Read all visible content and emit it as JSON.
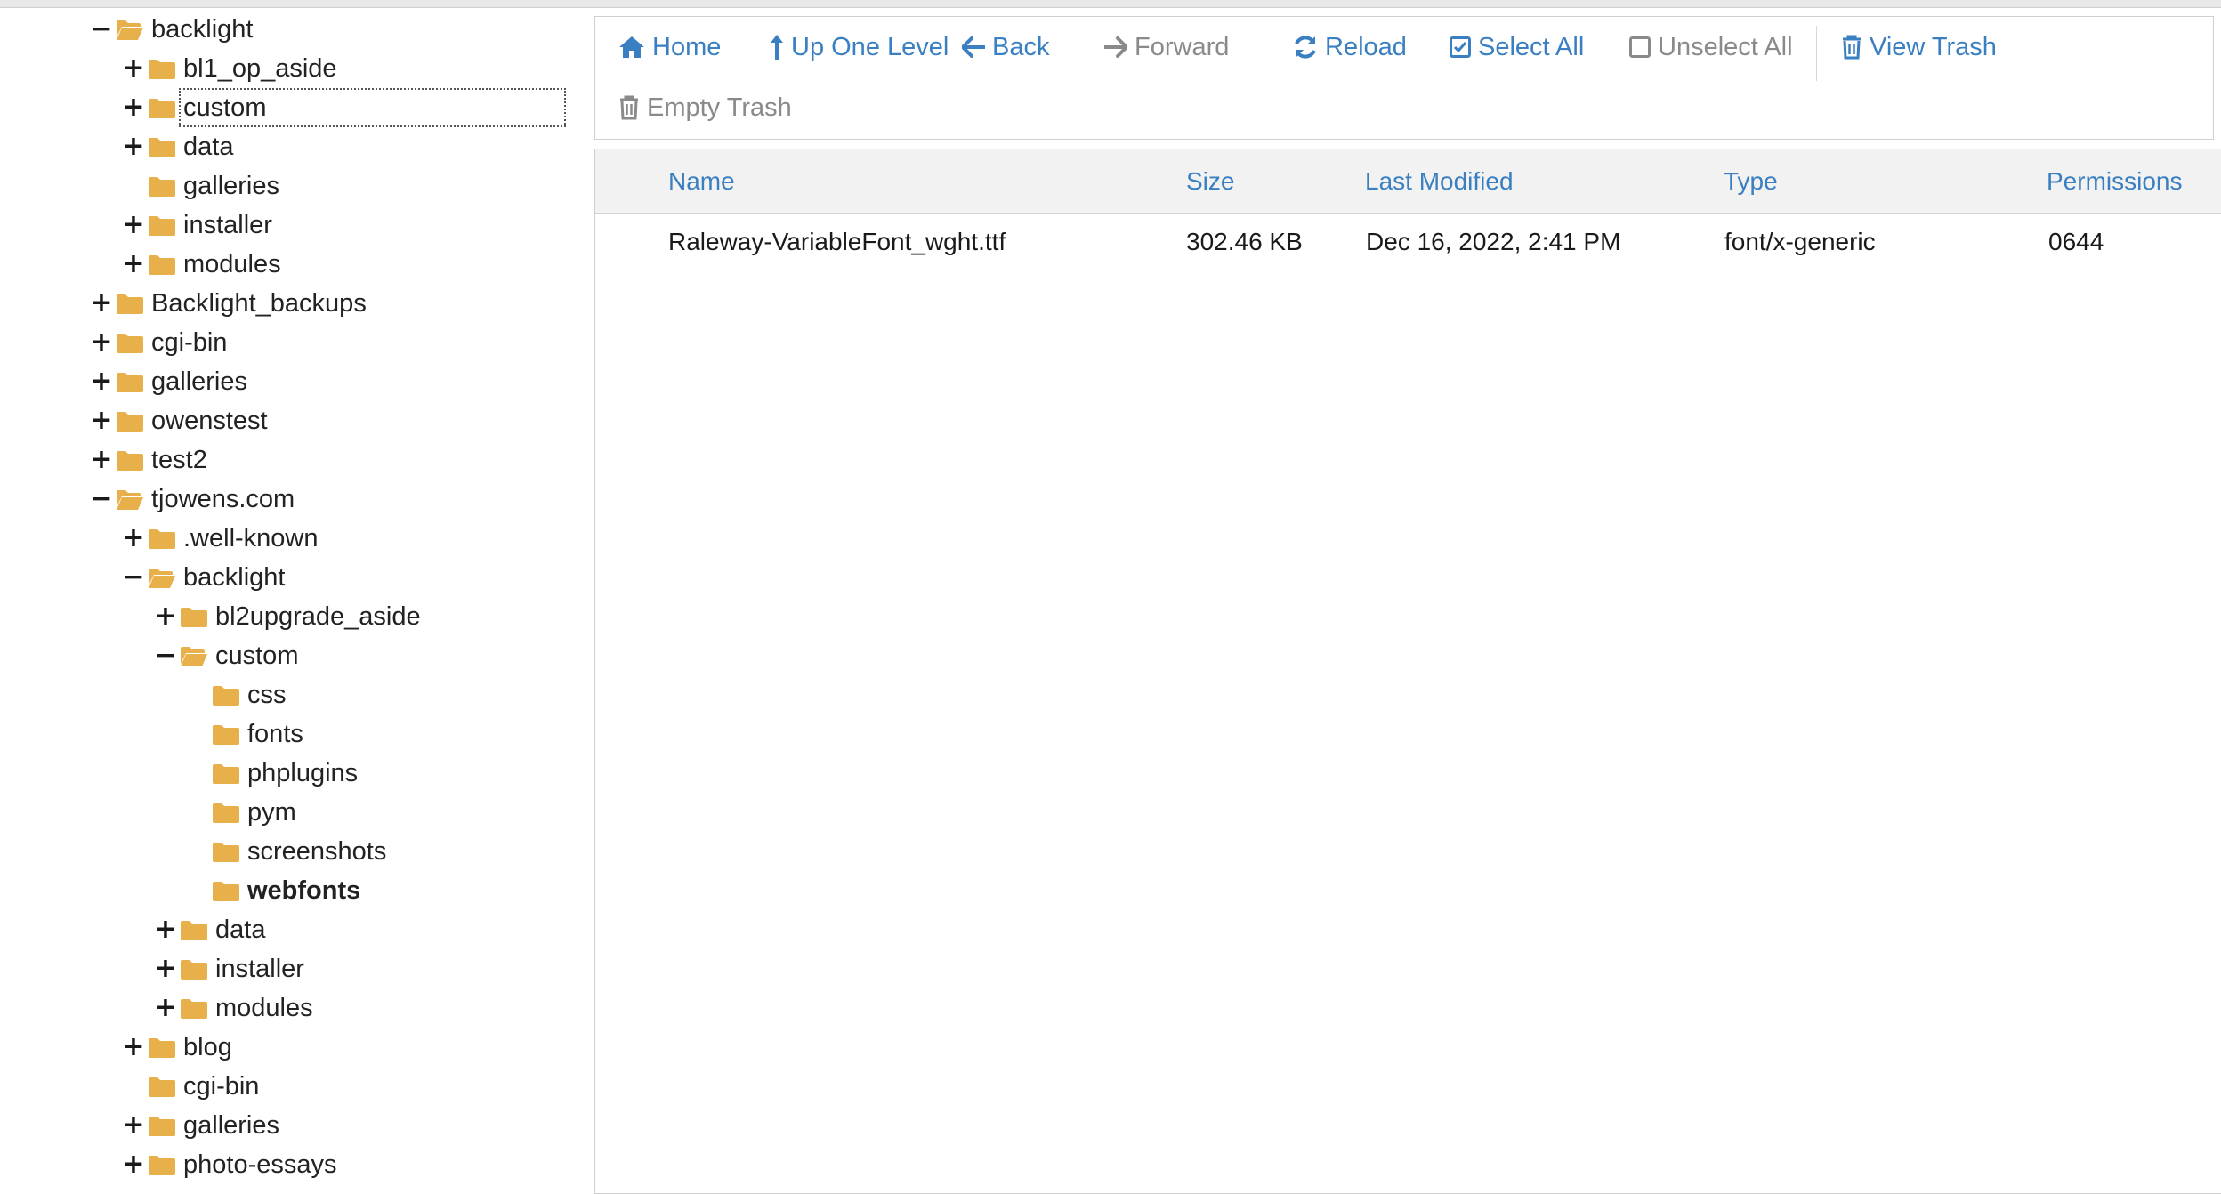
{
  "tree": [
    {
      "label": "backlight",
      "toggle": "−",
      "open": true
    },
    {
      "label": "bl1_op_aside",
      "toggle": "+",
      "open": false
    },
    {
      "label": "custom",
      "toggle": "+",
      "open": false,
      "focused": true
    },
    {
      "label": "data",
      "toggle": "+",
      "open": false
    },
    {
      "label": "galleries",
      "toggle": "",
      "open": false
    },
    {
      "label": "installer",
      "toggle": "+",
      "open": false
    },
    {
      "label": "modules",
      "toggle": "+",
      "open": false
    },
    {
      "label": "Backlight_backups",
      "toggle": "+",
      "open": false
    },
    {
      "label": "cgi-bin",
      "toggle": "+",
      "open": false
    },
    {
      "label": "galleries",
      "toggle": "+",
      "open": false
    },
    {
      "label": "owenstest",
      "toggle": "+",
      "open": false
    },
    {
      "label": "test2",
      "toggle": "+",
      "open": false
    },
    {
      "label": "tjowens.com",
      "toggle": "−",
      "open": true
    },
    {
      "label": ".well-known",
      "toggle": "+",
      "open": false
    },
    {
      "label": "backlight",
      "toggle": "−",
      "open": true
    },
    {
      "label": "bl2upgrade_aside",
      "toggle": "+",
      "open": false
    },
    {
      "label": "custom",
      "toggle": "−",
      "open": true
    },
    {
      "label": "css",
      "toggle": "",
      "open": false
    },
    {
      "label": "fonts",
      "toggle": "",
      "open": false
    },
    {
      "label": "phplugins",
      "toggle": "",
      "open": false
    },
    {
      "label": "pym",
      "toggle": "",
      "open": false
    },
    {
      "label": "screenshots",
      "toggle": "",
      "open": false
    },
    {
      "label": "webfonts",
      "toggle": "",
      "open": false,
      "selected": true
    },
    {
      "label": "data",
      "toggle": "+",
      "open": false
    },
    {
      "label": "installer",
      "toggle": "+",
      "open": false
    },
    {
      "label": "modules",
      "toggle": "+",
      "open": false
    },
    {
      "label": "blog",
      "toggle": "+",
      "open": false
    },
    {
      "label": "cgi-bin",
      "toggle": "",
      "open": false
    },
    {
      "label": "galleries",
      "toggle": "+",
      "open": false
    },
    {
      "label": "photo-essays",
      "toggle": "+",
      "open": false
    }
  ],
  "toolbar": {
    "home": "Home",
    "up_one_level": "Up One Level",
    "back": "Back",
    "forward": "Forward",
    "reload": "Reload",
    "select_all": "Select All",
    "unselect_all": "Unselect All",
    "view_trash": "View Trash",
    "empty_trash": "Empty Trash"
  },
  "table": {
    "columns": {
      "name": "Name",
      "size": "Size",
      "modified": "Last Modified",
      "type": "Type",
      "permissions": "Permissions"
    },
    "rows": [
      {
        "name": "Raleway-VariableFont_wght.ttf",
        "size": "302.46 KB",
        "modified": "Dec 16, 2022, 2:41 PM",
        "type": "font/x-generic",
        "permissions": "0644"
      }
    ]
  },
  "colors": {
    "link": "#3a7fc1",
    "disabled": "#8a8a8a",
    "folder": "#e8b04a",
    "header_bg": "#f2f2f2"
  }
}
